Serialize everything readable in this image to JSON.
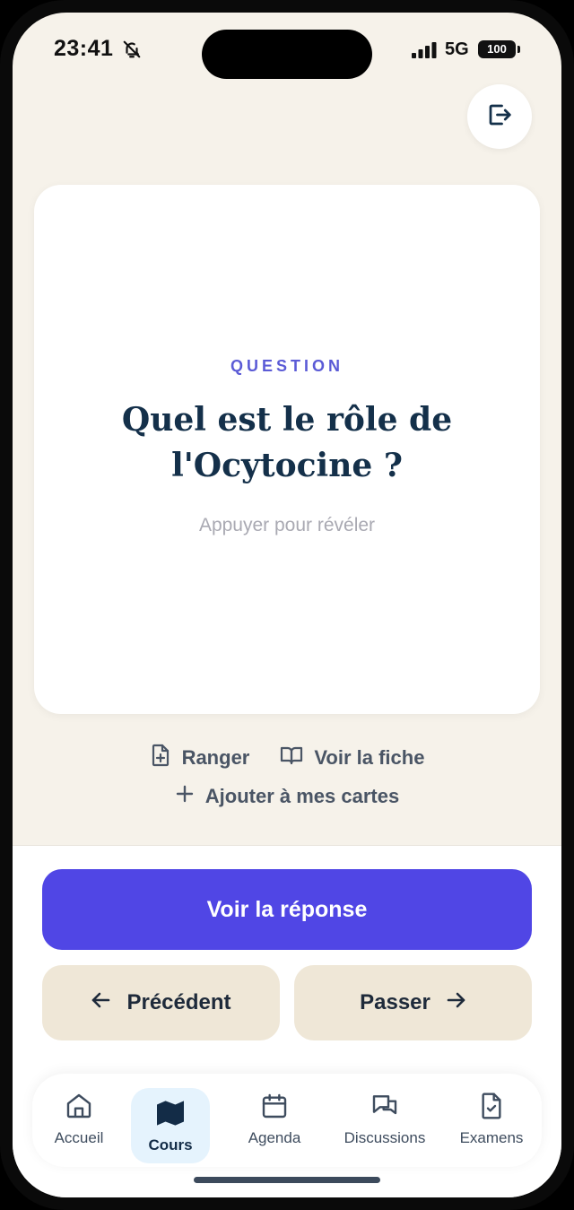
{
  "status_bar": {
    "time": "23:41",
    "network": "5G",
    "battery": "100"
  },
  "card": {
    "label": "QUESTION",
    "question": "Quel est le rôle de l'Ocytocine ?",
    "hint": "Appuyer pour révéler"
  },
  "card_actions": {
    "store_label": "Ranger",
    "sheet_label": "Voir la fiche",
    "add_label": "Ajouter à mes cartes"
  },
  "buttons": {
    "reveal": "Voir la réponse",
    "previous": "Précédent",
    "skip": "Passer"
  },
  "nav": {
    "items": [
      {
        "label": "Accueil",
        "icon": "home-icon"
      },
      {
        "label": "Cours",
        "icon": "map-icon",
        "active": true
      },
      {
        "label": "Agenda",
        "icon": "calendar-icon"
      },
      {
        "label": "Discussions",
        "icon": "chat-icon"
      },
      {
        "label": "Examens",
        "icon": "exam-icon"
      }
    ]
  },
  "colors": {
    "accent": "#5046E5",
    "background": "#F6F2EA",
    "label": "#5B5BD6",
    "title": "#14304A",
    "secondary_button": "#EFE7D7",
    "nav_active": "#E5F3FD"
  }
}
